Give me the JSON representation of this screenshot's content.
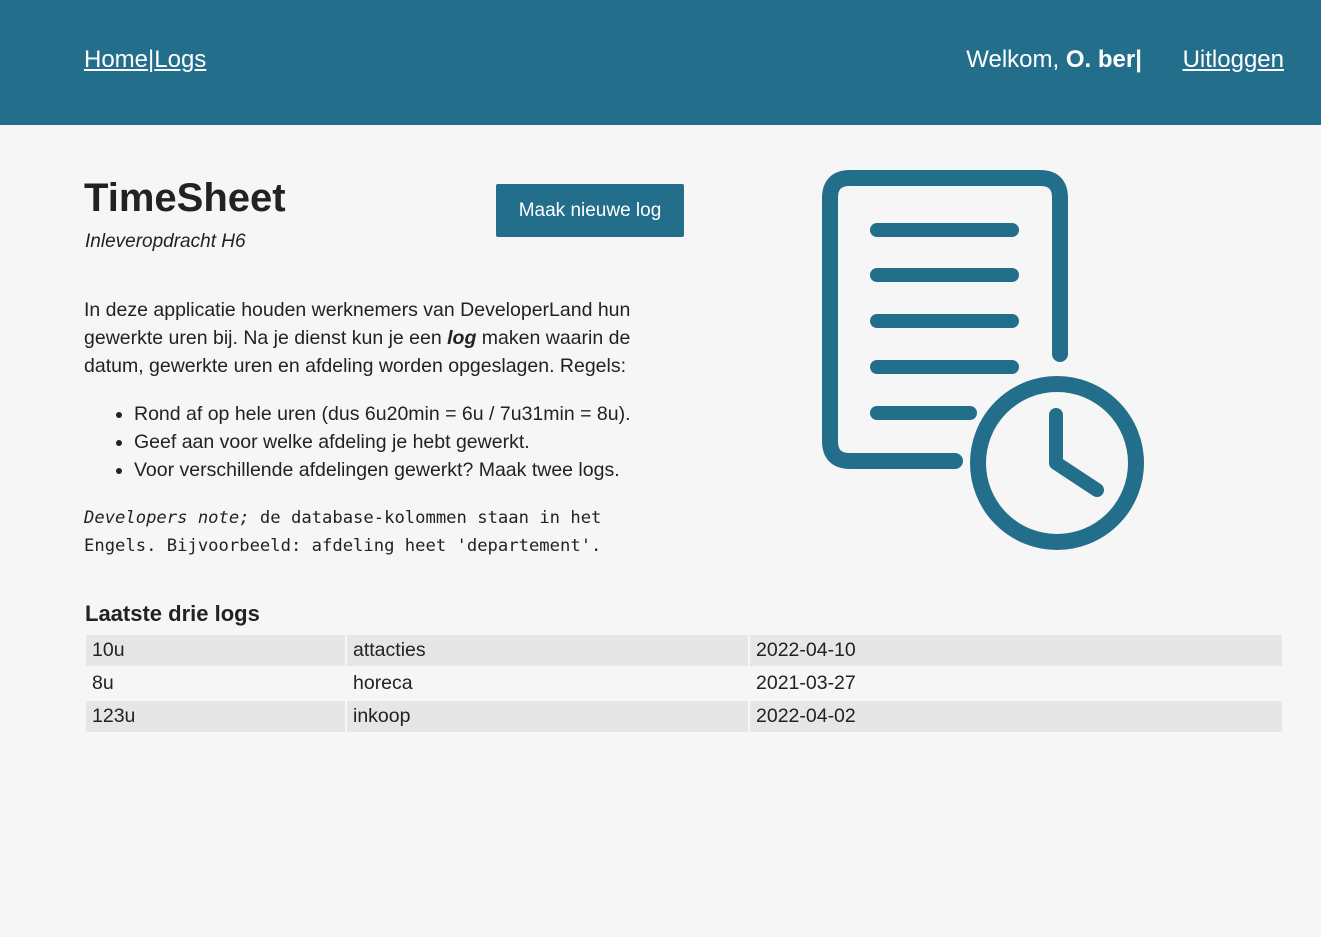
{
  "nav": {
    "home": "Home",
    "separator": "|",
    "logs": "Logs",
    "welcome_prefix": "Welkom, ",
    "user": "O. ber|",
    "logout": "Uitloggen"
  },
  "header": {
    "title": "TimeSheet",
    "subtitle": "Inleveropdracht H6",
    "new_log_button": "Maak nieuwe log"
  },
  "intro": {
    "part1": "In deze applicatie houden werknemers van DeveloperLand hun gewerkte uren bij. Na je dienst kun je een ",
    "emphasis": "log",
    "part2": " maken waarin de datum, gewerkte uren en afdeling worden opgeslagen. Regels:"
  },
  "rules": [
    "Rond af op hele uren (dus 6u20min = 6u / 7u31min = 8u).",
    "Geef aan voor welke afdeling je hebt gewerkt.",
    "Voor verschillende afdelingen gewerkt? Maak twee logs."
  ],
  "devnote": {
    "label": "Developers note;",
    "text": " de database-kolommen staan in het Engels. Bijvoorbeeld: afdeling heet 'departement'."
  },
  "illustration": {
    "icon": "timesheet-document-clock-icon",
    "color": "#236f8b"
  },
  "logs": {
    "title": "Laatste drie logs",
    "rows": [
      {
        "hours": "10u",
        "department": "attacties",
        "date": "2022-04-10"
      },
      {
        "hours": "8u",
        "department": "horeca",
        "date": "2021-03-27"
      },
      {
        "hours": "123u",
        "department": "inkoop",
        "date": "2022-04-02"
      }
    ]
  },
  "colors": {
    "primary": "#236f8b",
    "background": "#f6f6f6",
    "row_alt": "#e6e6e6"
  }
}
